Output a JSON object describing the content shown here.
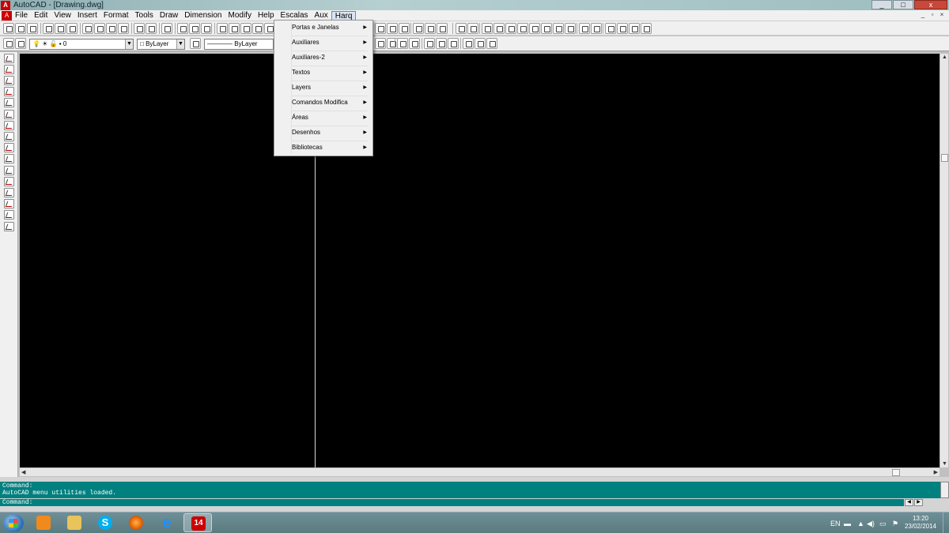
{
  "window": {
    "app_icon": "autocad-icon",
    "title": "AutoCAD - [Drawing.dwg]",
    "controls": [
      "_",
      "□",
      "x"
    ]
  },
  "menubar": {
    "items": [
      "File",
      "Edit",
      "View",
      "Insert",
      "Format",
      "Tools",
      "Draw",
      "Dimension",
      "Modify",
      "Help",
      "Escalas",
      "Aux",
      "Harq"
    ],
    "active": "Harq",
    "mdi_controls": [
      "_",
      "▫",
      "×"
    ]
  },
  "properties_toolbar": {
    "layer_value": "0",
    "color_value": "ByLayer",
    "linetype_value": "ByLayer"
  },
  "dropdown_menu": {
    "parent": "Harq",
    "items": [
      {
        "label": "Portas e Janelas",
        "submenu": true
      },
      {
        "label": "Auxiliares",
        "submenu": true
      },
      {
        "label": "Auxiliares-2",
        "submenu": true
      },
      {
        "label": "Textos",
        "submenu": true
      },
      {
        "label": "Layers",
        "submenu": true
      },
      {
        "label": "Comandos Modifica",
        "submenu": true
      },
      {
        "label": "Áreas",
        "submenu": true
      },
      {
        "label": "Desenhos",
        "submenu": true
      },
      {
        "label": "Bibliotecas",
        "submenu": true
      }
    ],
    "submenu_glyph": "▶"
  },
  "command_window": {
    "history": [
      "Command:",
      "AutoCAD menu utilities loaded."
    ],
    "prompt": "Command:"
  },
  "taskbar": {
    "apps": [
      {
        "name": "media-player",
        "color": "#f08a1c"
      },
      {
        "name": "file-explorer",
        "color": "#e8c45a"
      },
      {
        "name": "skype",
        "color": "#00aff0"
      },
      {
        "name": "firefox",
        "color": "#e66000"
      },
      {
        "name": "internet-explorer",
        "color": "#1e90ff"
      },
      {
        "name": "autocad-14",
        "color": "#cc0000",
        "label": "14"
      }
    ],
    "language": "EN",
    "time": "13:20",
    "date": "23/02/2014"
  },
  "colors": {
    "drawing_background": "#000000",
    "command_background": "#00807f",
    "menu_highlight": "#dbe6f2"
  }
}
